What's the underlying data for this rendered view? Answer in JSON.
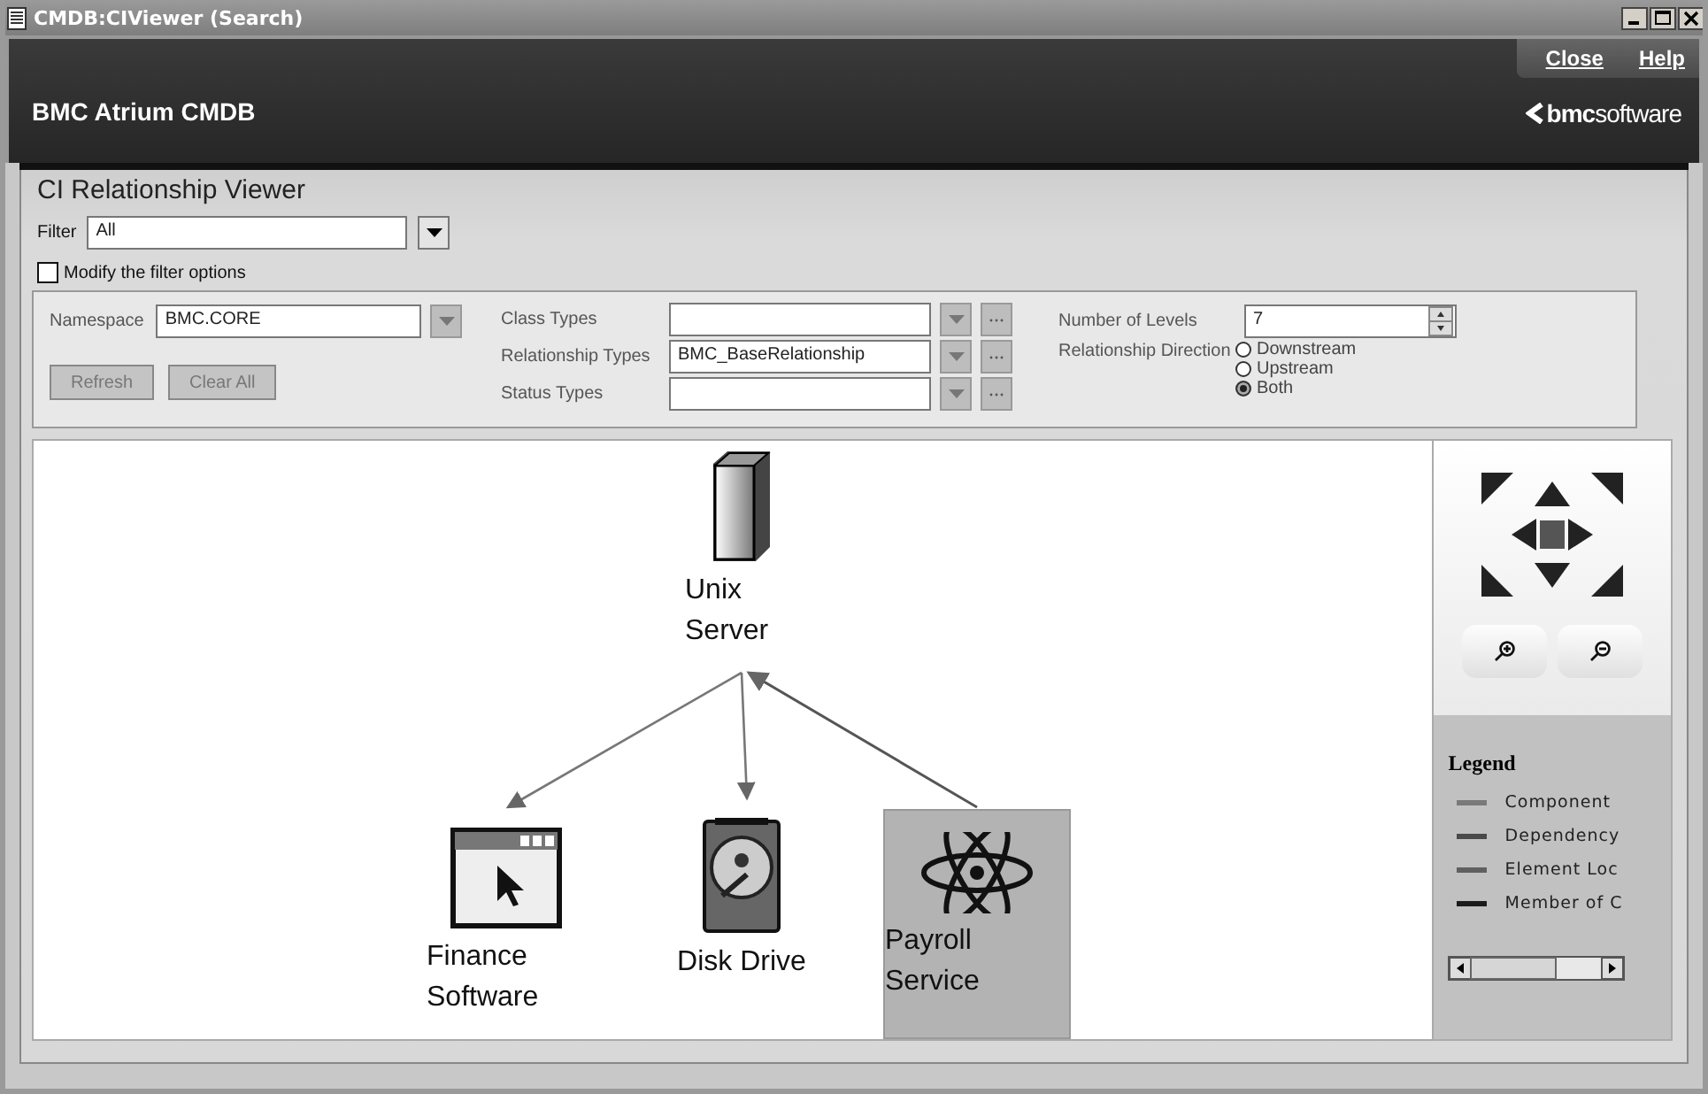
{
  "window": {
    "title": "CMDB:CIViewer (Search)"
  },
  "header": {
    "title": "BMC Atrium CMDB",
    "links": [
      "Close",
      "Help"
    ],
    "logo": "**bmc**software"
  },
  "viewer": {
    "title": "CI Relationship Viewer",
    "filter": {
      "label": "Filter",
      "value": "All"
    },
    "modify_filter": {
      "label": "Modify the filter options",
      "checked": false
    }
  },
  "options": {
    "namespace": {
      "label": "Namespace",
      "value": "BMC.CORE"
    },
    "buttons": [
      {
        "label": "Refresh",
        "disabled": true
      },
      {
        "label": "Clear All",
        "disabled": true
      }
    ],
    "type_fields": [
      {
        "label": "Class Types"
      },
      {
        "label": "Relationship Types",
        "value": "BMC_BaseRelationship"
      },
      {
        "label": "Status Types"
      }
    ],
    "levels": {
      "label": "Number of Levels",
      "value": "7"
    },
    "direction": {
      "label": "Relationship Direction",
      "options": [
        {
          "label": "Downstream",
          "selected": false
        },
        {
          "label": "Upstream",
          "selected": false
        },
        {
          "label": "Both",
          "selected": true
        }
      ]
    }
  },
  "diagram": {
    "nodes": [
      {
        "label": "Unix Server",
        "kind": "server",
        "selected": false
      },
      {
        "label": "Finance Software",
        "kind": "software",
        "selected": false
      },
      {
        "label": "Disk Drive",
        "kind": "disk",
        "selected": false
      },
      {
        "label": "Payroll Service",
        "kind": "service",
        "selected": true
      }
    ]
  },
  "legend": {
    "title": "Legend",
    "items": [
      {
        "label": "Component",
        "color": "#7a7a7a"
      },
      {
        "label": "Dependency",
        "color": "#4a4a4a"
      },
      {
        "label": "Element Loc",
        "color": "#606060"
      },
      {
        "label": "Member of C",
        "color": "#1c1c1c"
      }
    ]
  }
}
